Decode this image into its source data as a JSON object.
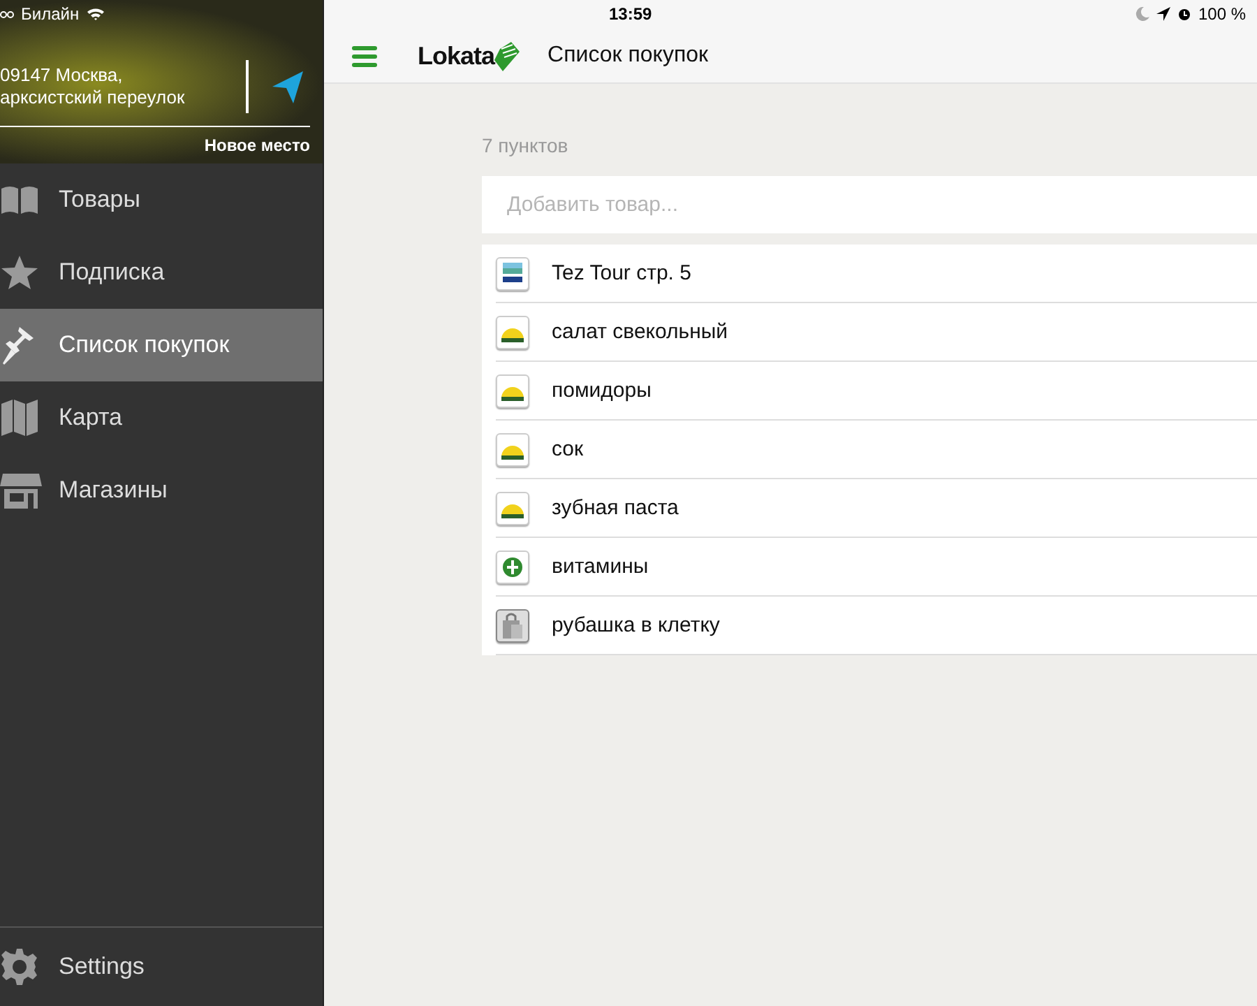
{
  "status_bar": {
    "carrier": "Билайн",
    "time": "13:59",
    "battery": "100 %"
  },
  "sidebar": {
    "address": [
      "09147 Москва,",
      "арксистский переулок"
    ],
    "new_place": "Новое место",
    "items": [
      {
        "kind": "book",
        "label": "Товары",
        "selected": false
      },
      {
        "kind": "star",
        "label": "Подписка",
        "selected": false
      },
      {
        "kind": "pin",
        "label": "Список покупок",
        "selected": true
      },
      {
        "kind": "map",
        "label": "Карта",
        "selected": false
      },
      {
        "kind": "store",
        "label": "Магазины",
        "selected": false
      }
    ],
    "settings": "Settings"
  },
  "header": {
    "logo": "Lokata",
    "title": "Список покупок"
  },
  "list": {
    "count": "7 пунктов",
    "add_placeholder": "Добавить товар...",
    "items": [
      {
        "kind": "tour",
        "label": "Tez Tour стр. 5"
      },
      {
        "kind": "yellow",
        "label": "салат свекольный"
      },
      {
        "kind": "yellow",
        "label": "помидоры"
      },
      {
        "kind": "yellow",
        "label": "сок"
      },
      {
        "kind": "yellow",
        "label": "зубная паста"
      },
      {
        "kind": "green",
        "label": "витамины"
      },
      {
        "kind": "bag",
        "label": "рубашка в клетку"
      }
    ]
  }
}
